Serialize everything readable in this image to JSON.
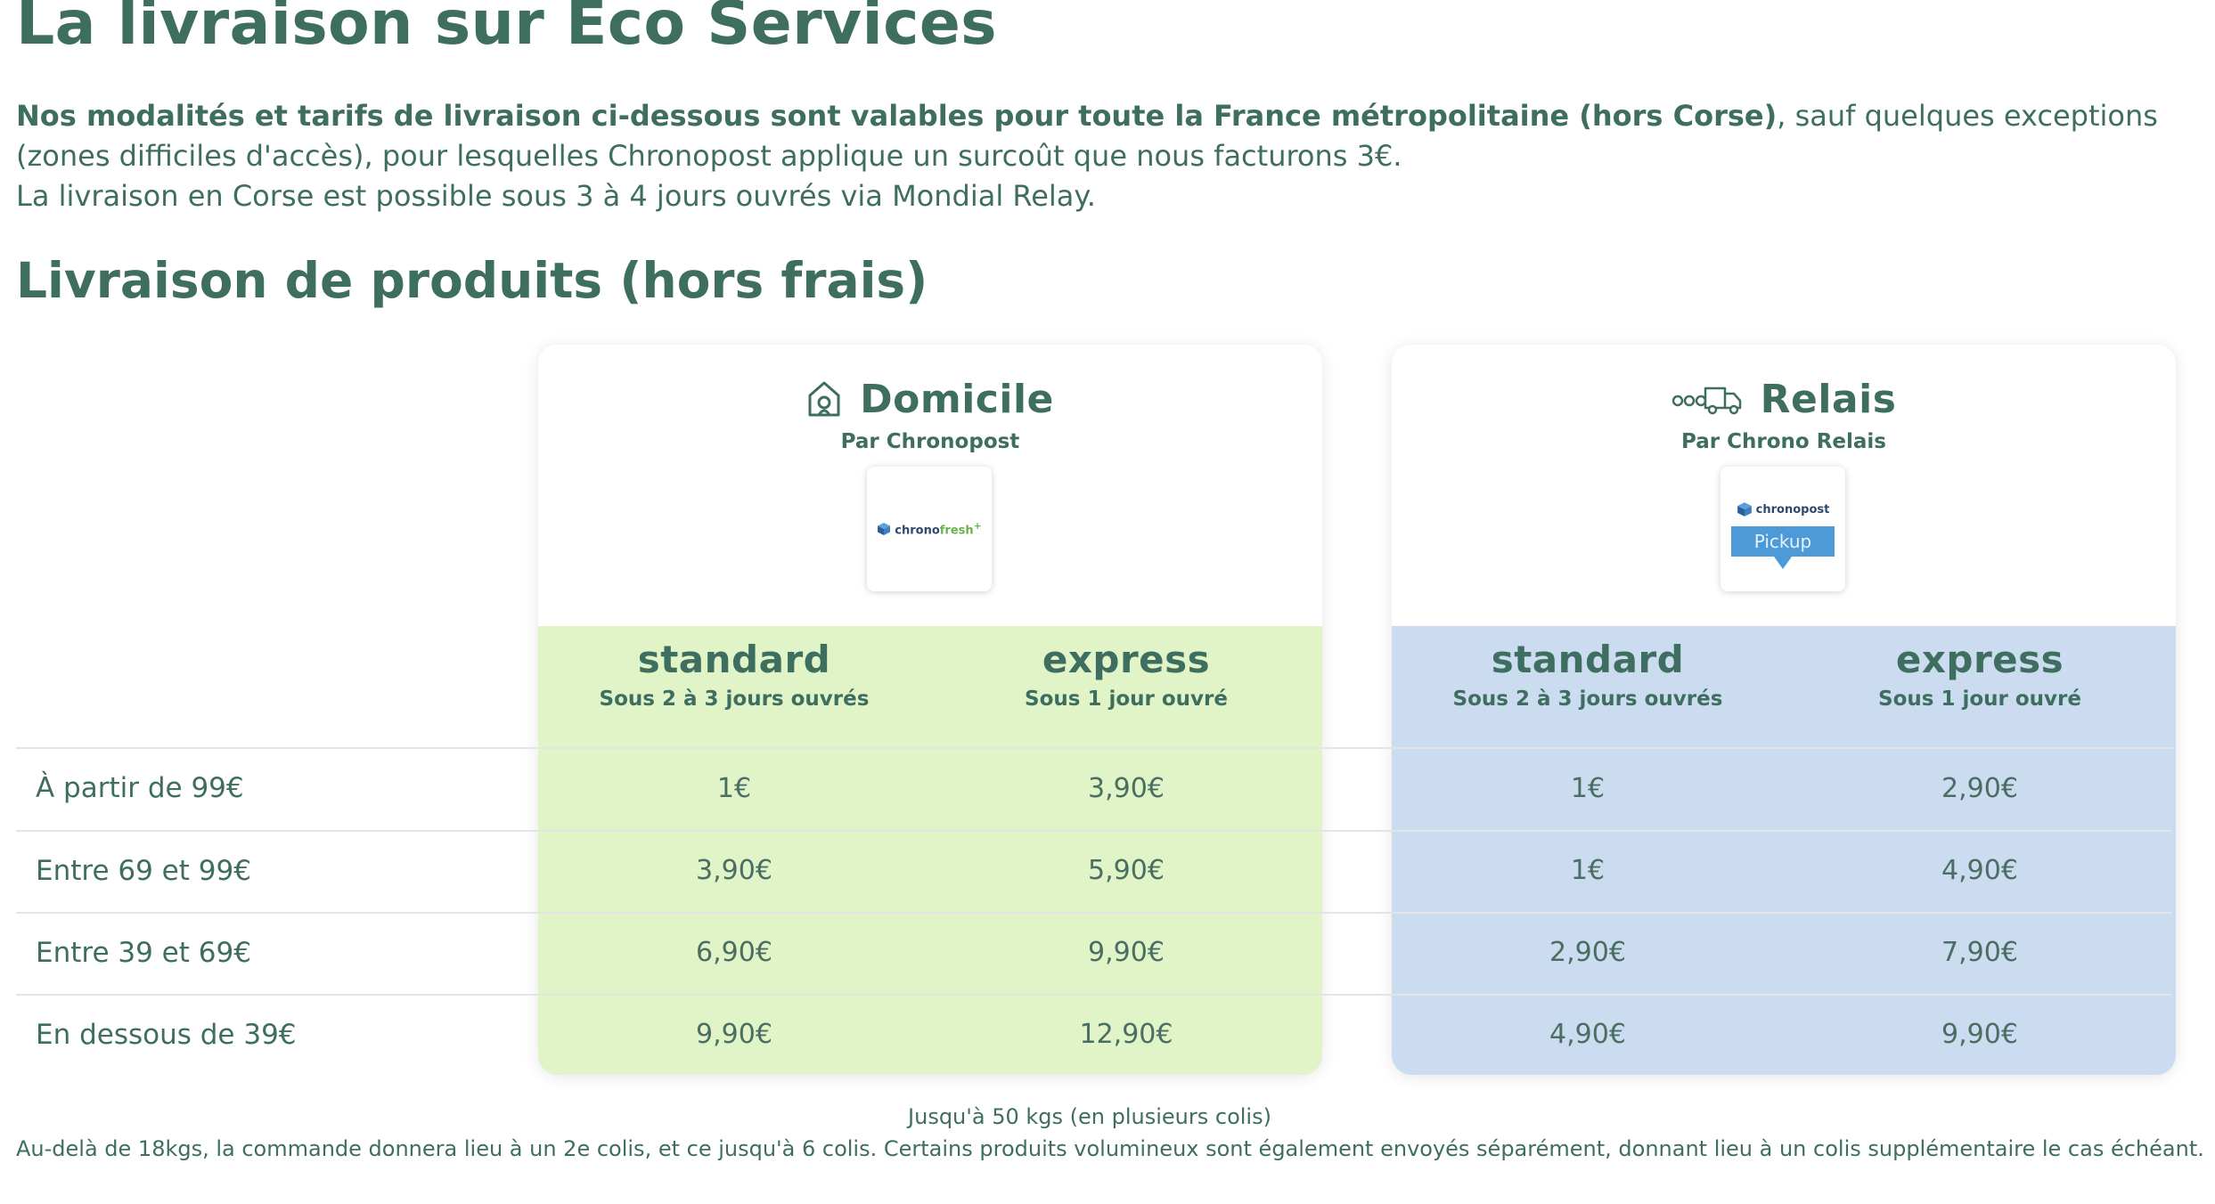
{
  "page": {
    "title": "La livraison sur Eco Services",
    "intro_bold": "Nos modalités et tarifs de livraison ci-dessous sont valables pour toute la France métropolitaine (hors Corse)",
    "intro_rest": ", sauf quelques exceptions (zones difficiles d'accès), pour lesquelles Chronopost applique un surcoût que nous facturons 3€.",
    "intro_line2": "La livraison en Corse est possible sous 3 à 4 jours ouvrés via Mondial Relay.",
    "subtitle": "Livraison de produits (hors frais)"
  },
  "cards": {
    "domicile": {
      "title": "Domicile",
      "by": "Par Chronopost",
      "icon": "house-icon",
      "logo_text": "chrono",
      "logo_text_accent": "fresh",
      "logo_sup": "+",
      "color": "#e0f4c8"
    },
    "relais": {
      "title": "Relais",
      "by": "Par Chrono Relais",
      "icon": "delivery-truck-icon",
      "logo_text": "chronopost",
      "logo_pickup": "Pickup",
      "color": "#cbdcf0"
    }
  },
  "columns": {
    "standard": {
      "name": "standard",
      "delay": "Sous 2 à 3 jours ouvrés"
    },
    "express": {
      "name": "express",
      "delay": "Sous 1 jour ouvré"
    }
  },
  "rows": [
    {
      "label": "À partir de 99€",
      "dom_std": "1€",
      "dom_exp": "3,90€",
      "rel_std": "1€",
      "rel_exp": "2,90€"
    },
    {
      "label": "Entre 69 et 99€",
      "dom_std": "3,90€",
      "dom_exp": "5,90€",
      "rel_std": "1€",
      "rel_exp": "4,90€"
    },
    {
      "label": "Entre 39 et 69€",
      "dom_std": "6,90€",
      "dom_exp": "9,90€",
      "rel_std": "2,90€",
      "rel_exp": "7,90€"
    },
    {
      "label": "En dessous de 39€",
      "dom_std": "9,90€",
      "dom_exp": "12,90€",
      "rel_std": "4,90€",
      "rel_exp": "9,90€"
    }
  ],
  "footer": {
    "weight_note": "Jusqu'à 50 kgs (en plusieurs colis)",
    "parcel_note": "Au-delà de 18kgs, la commande donnera lieu à un 2e colis, et ce jusqu'à 6 colis. Certains produits volumineux sont également envoyés séparément, donnant lieu à un colis supplémentaire le cas échéant."
  }
}
